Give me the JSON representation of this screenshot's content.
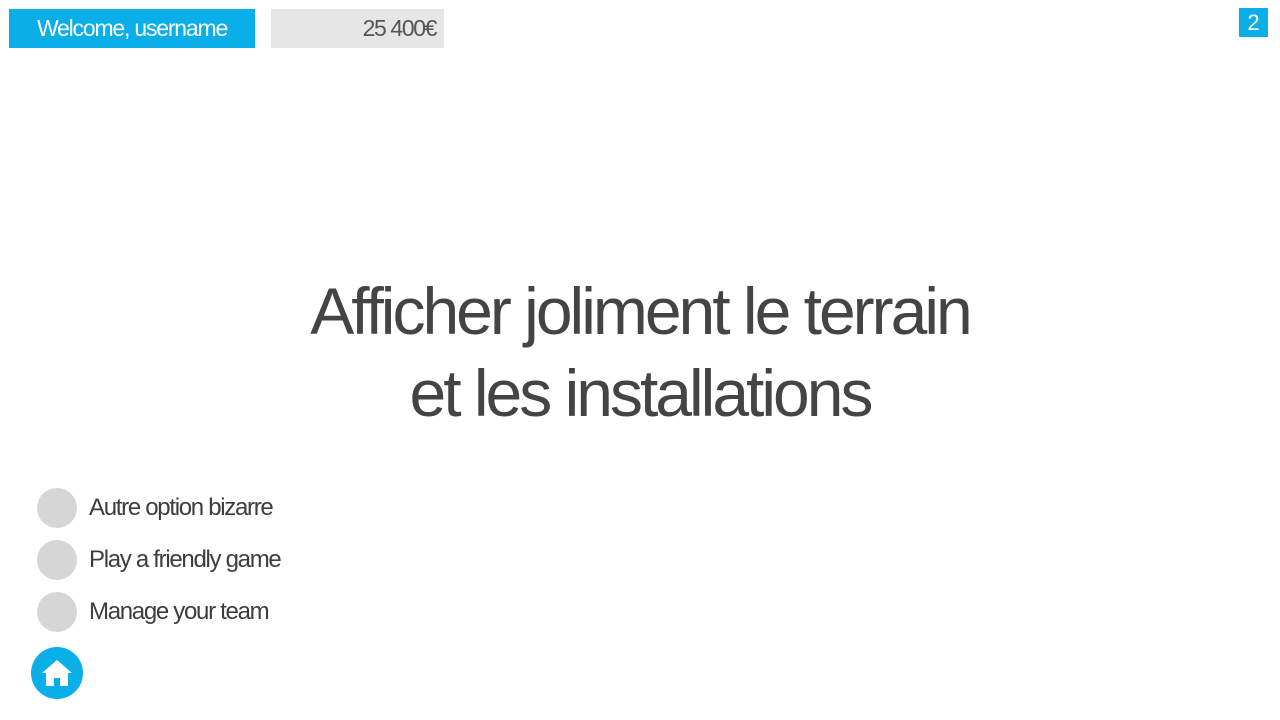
{
  "header": {
    "welcome_text": "Welcome, username",
    "balance": "25 400€",
    "page_number": "2"
  },
  "main": {
    "headline_line1": "Afficher joliment le terrain",
    "headline_line2": "et les installations"
  },
  "menu": {
    "items": [
      {
        "label": "Autre option bizarre"
      },
      {
        "label": "Play a friendly game"
      },
      {
        "label": "Manage your team"
      }
    ]
  },
  "footer": {
    "home_icon": "home-icon"
  },
  "colors": {
    "accent": "#0aaee9",
    "balance_bg": "#e6e6e6",
    "dot": "#d6d6d6",
    "text": "#444444"
  }
}
